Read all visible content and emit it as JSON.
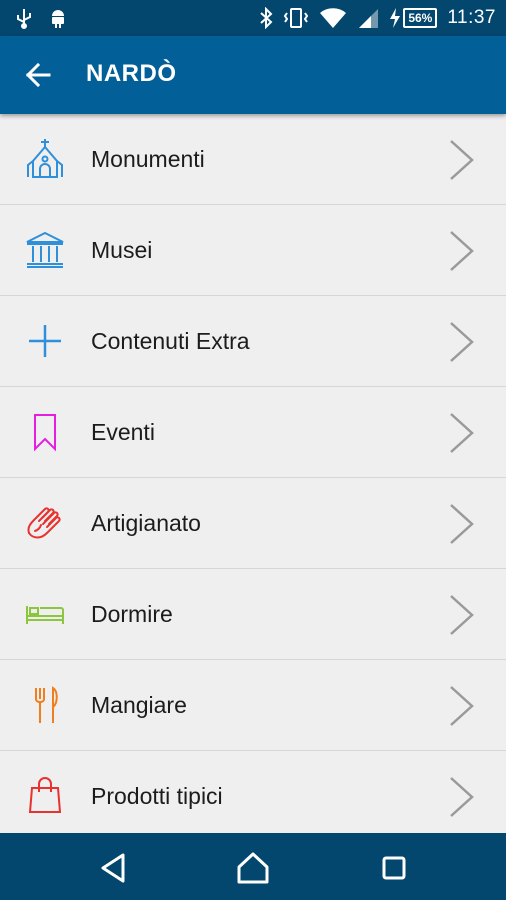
{
  "status_bar": {
    "left_icons": [
      "usb-icon",
      "android-icon"
    ],
    "right_icons": [
      "bluetooth-icon",
      "vibrate-icon",
      "wifi-icon",
      "signal-icon",
      "charging-icon"
    ],
    "battery_level": "56%",
    "time": "11:37"
  },
  "app_bar": {
    "title": "NARDÒ",
    "back_icon": "arrow-back-icon"
  },
  "menu": {
    "items": [
      {
        "label": "Monumenti",
        "icon": "church-icon",
        "color": "#2e8fdb"
      },
      {
        "label": "Musei",
        "icon": "museum-icon",
        "color": "#2e8fdb"
      },
      {
        "label": "Contenuti Extra",
        "icon": "plus-icon",
        "color": "#2e8fdb"
      },
      {
        "label": "Eventi",
        "icon": "bookmark-icon",
        "color": "#e61ee0"
      },
      {
        "label": "Artigianato",
        "icon": "hands-icon",
        "color": "#e8322f"
      },
      {
        "label": "Dormire",
        "icon": "bed-icon",
        "color": "#8cc63f"
      },
      {
        "label": "Mangiare",
        "icon": "fork-knife-icon",
        "color": "#f07d1e"
      },
      {
        "label": "Prodotti tipici",
        "icon": "shopping-bag-icon",
        "color": "#e8322f"
      }
    ]
  },
  "nav_bar": {
    "buttons": [
      "back-triangle-icon",
      "home-icon",
      "recents-icon"
    ]
  },
  "colors": {
    "status_bar": "#03466e",
    "app_bar": "#025f98",
    "background": "#efefef",
    "chevron": "#9a9a9a"
  }
}
